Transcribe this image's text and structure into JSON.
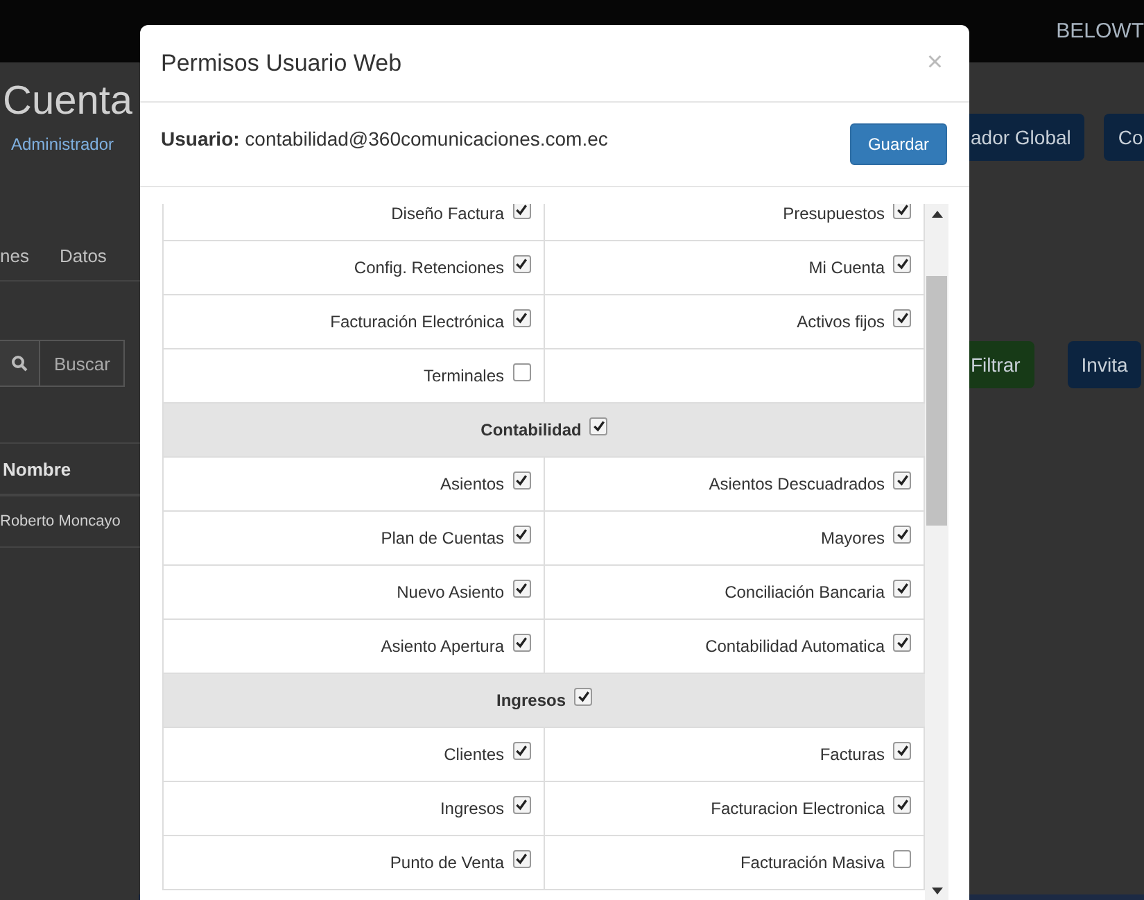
{
  "navbar": {
    "brand": "BELOWT"
  },
  "page": {
    "title": "Cuenta",
    "breadcrumb": "Administrador",
    "header_buttons": [
      "ador Global",
      "Co"
    ],
    "tabs": [
      "nes",
      "Datos"
    ],
    "search": {
      "placeholder": "Buscar"
    },
    "filter_buttons": [
      {
        "label": "Filtrar",
        "kind": "success"
      },
      {
        "label": "Invita",
        "kind": "primary"
      }
    ],
    "table": {
      "columns": [
        "Nombre"
      ],
      "rows": [
        [
          "Roberto Moncayo"
        ]
      ]
    }
  },
  "modal": {
    "title": "Permisos Usuario Web",
    "close": "×",
    "user_label": "Usuario:",
    "user_value": "contabilidad@360comunicaciones.com.ec",
    "save_button": "Guardar",
    "permissions": [
      {
        "kind": "row",
        "cells": [
          {
            "label": "Diseño Factura",
            "checked": true
          },
          {
            "label": "Presupuestos",
            "checked": true
          }
        ]
      },
      {
        "kind": "row",
        "cells": [
          {
            "label": "Config. Retenciones",
            "checked": true
          },
          {
            "label": "Mi Cuenta",
            "checked": true
          }
        ]
      },
      {
        "kind": "row",
        "cells": [
          {
            "label": "Facturación Electrónica",
            "checked": true
          },
          {
            "label": "Activos fijos",
            "checked": true
          }
        ]
      },
      {
        "kind": "row",
        "cells": [
          {
            "label": "Terminales",
            "checked": false
          }
        ]
      },
      {
        "kind": "section",
        "title": "Contabilidad",
        "checked": true
      },
      {
        "kind": "row",
        "cells": [
          {
            "label": "Asientos",
            "checked": true
          },
          {
            "label": "Asientos Descuadrados",
            "checked": true
          }
        ]
      },
      {
        "kind": "row",
        "cells": [
          {
            "label": "Plan de Cuentas",
            "checked": true
          },
          {
            "label": "Mayores",
            "checked": true
          }
        ]
      },
      {
        "kind": "row",
        "cells": [
          {
            "label": "Nuevo Asiento",
            "checked": true
          },
          {
            "label": "Conciliación Bancaria",
            "checked": true
          }
        ]
      },
      {
        "kind": "row",
        "cells": [
          {
            "label": "Asiento Apertura",
            "checked": true
          },
          {
            "label": "Contabilidad Automatica",
            "checked": true
          }
        ]
      },
      {
        "kind": "section",
        "title": "Ingresos",
        "checked": true
      },
      {
        "kind": "row",
        "cells": [
          {
            "label": "Clientes",
            "checked": true
          },
          {
            "label": "Facturas",
            "checked": true
          }
        ]
      },
      {
        "kind": "row",
        "cells": [
          {
            "label": "Ingresos",
            "checked": true
          },
          {
            "label": "Facturacion Electronica",
            "checked": true
          }
        ]
      },
      {
        "kind": "row",
        "cells": [
          {
            "label": "Punto de Venta",
            "checked": true
          },
          {
            "label": "Facturación Masiva",
            "checked": false
          }
        ]
      }
    ]
  }
}
